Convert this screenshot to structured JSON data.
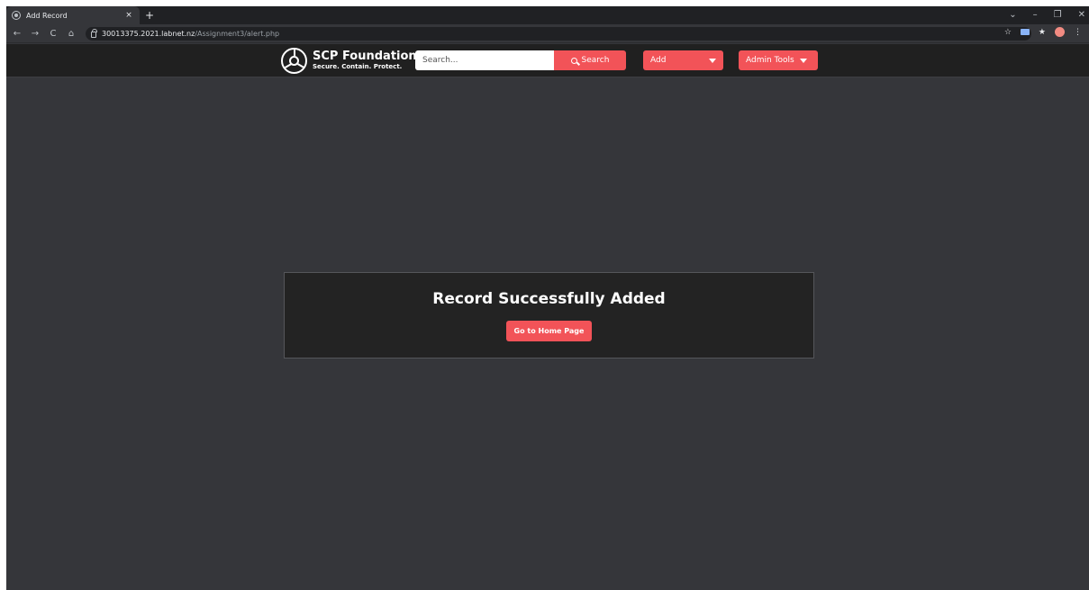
{
  "browser": {
    "tab_title": "Add Record",
    "tab_close": "×",
    "new_tab": "+",
    "url_host": "30013375.2021.labnet.nz",
    "url_path": "/Assignment3/alert.php",
    "window_controls": {
      "dropdown": "⌄",
      "minimize": "–",
      "maximize": "❐",
      "close": "✕"
    },
    "nav": {
      "back": "←",
      "forward": "→",
      "reload": "C",
      "home": "⌂"
    },
    "toolbar": {
      "star": "☆",
      "puzzle": "★",
      "menu": "⋮"
    }
  },
  "site": {
    "logo_title": "SCP Foundation",
    "logo_subtitle": "Secure. Contain. Protect.",
    "search_placeholder": "Search...",
    "search_button": "Search",
    "add_dropdown": "Add",
    "admin_dropdown": "Admin Tools"
  },
  "alert": {
    "title": "Record Successfully Added",
    "button": "Go to Home Page"
  },
  "colors": {
    "accent": "#f25358",
    "page_bg": "#35363a",
    "navbar_bg": "#202020",
    "panel_bg": "#232323"
  }
}
